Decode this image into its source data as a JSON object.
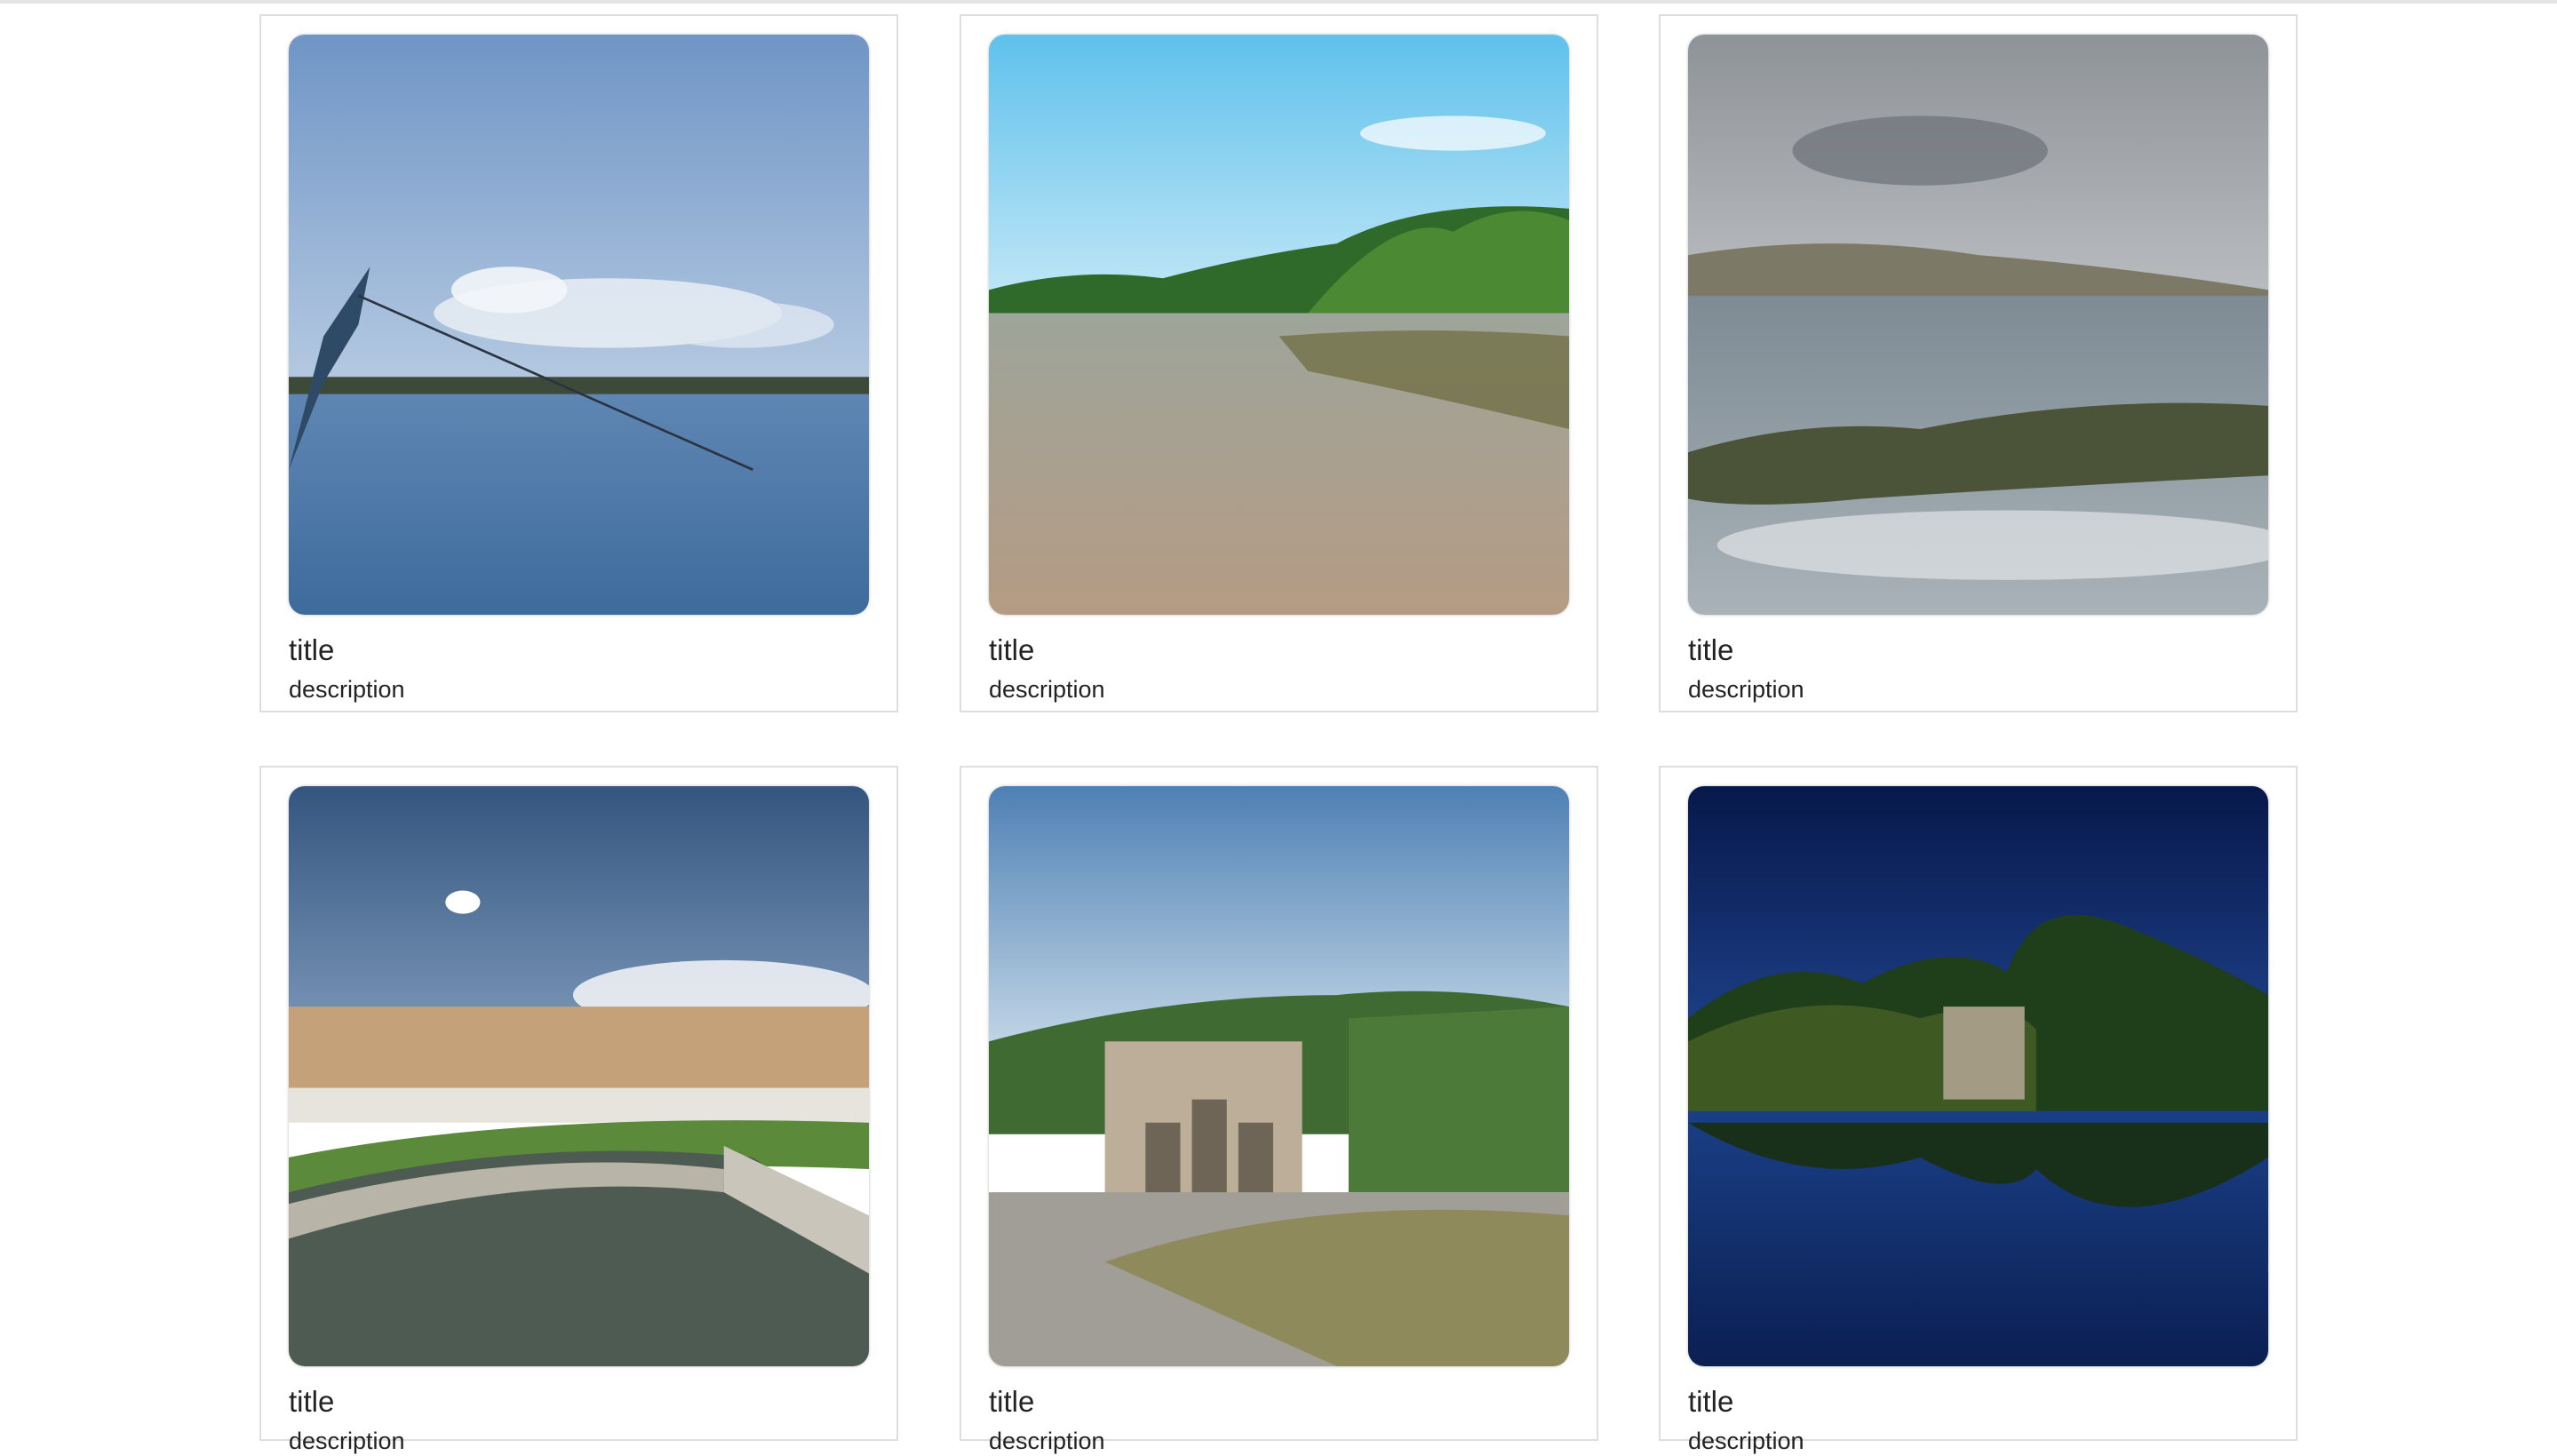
{
  "cards": [
    {
      "title": "title",
      "description": "description",
      "image_subject": "lagoon-with-boat-bow"
    },
    {
      "title": "title",
      "description": "description",
      "image_subject": "palm-beach-reflection"
    },
    {
      "title": "title",
      "description": "description",
      "image_subject": "rocky-coast-waves"
    },
    {
      "title": "title",
      "description": "description",
      "image_subject": "canal-with-statues"
    },
    {
      "title": "title",
      "description": "description",
      "image_subject": "triumphal-arch-ruins"
    },
    {
      "title": "title",
      "description": "description",
      "image_subject": "lake-temple-night"
    }
  ]
}
